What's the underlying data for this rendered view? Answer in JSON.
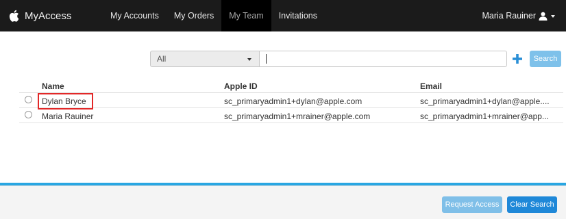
{
  "navbar": {
    "brand": "MyAccess",
    "items": [
      {
        "label": "My Accounts",
        "active": false
      },
      {
        "label": "My Orders",
        "active": false
      },
      {
        "label": "My Team",
        "active": true
      },
      {
        "label": "Invitations",
        "active": false
      }
    ],
    "user_name": "Maria Rauiner",
    "user_icon": "user-icon"
  },
  "search": {
    "filter_value": "All",
    "query": "",
    "add_icon": "plus-icon",
    "search_label": "Search"
  },
  "table": {
    "columns": [
      "Name",
      "Apple ID",
      "Email"
    ],
    "rows": [
      {
        "name": "Dylan Bryce",
        "apple_id": "sc_primaryadmin1+dylan@apple.com",
        "email": "sc_primaryadmin1+dylan@apple....",
        "selected": false,
        "highlighted": true
      },
      {
        "name": "Maria Rauiner",
        "apple_id": "sc_primaryadmin1+mrainer@apple.com",
        "email": "sc_primaryadmin1+mrainer@app...",
        "selected": false,
        "highlighted": false
      }
    ]
  },
  "footer": {
    "request_access_label": "Request Access",
    "clear_search_label": "Clear Search"
  },
  "colors": {
    "navbar_bg": "#1b1b1b",
    "accent": "#29a6e2",
    "primary_button": "#1f88d8",
    "disabled_button": "#7fbfe8",
    "highlight": "#e22828"
  }
}
